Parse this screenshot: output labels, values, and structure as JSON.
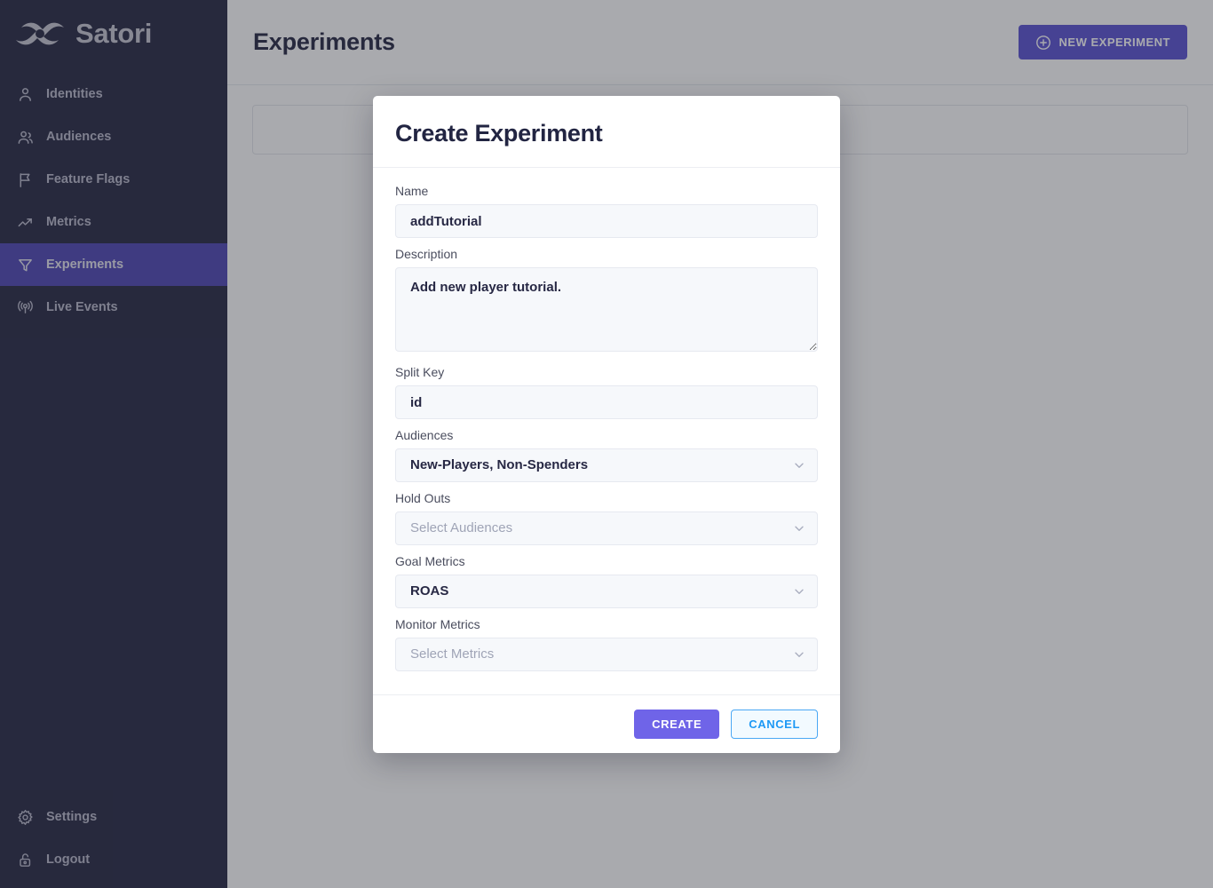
{
  "sidebar": {
    "brand": {
      "name": "Satori",
      "logo_icon": "satori-loop-logo"
    },
    "items": [
      {
        "label": "Identities",
        "icon": "user-icon",
        "active": false
      },
      {
        "label": "Audiences",
        "icon": "users-icon",
        "active": false
      },
      {
        "label": "Feature Flags",
        "icon": "flag-icon",
        "active": false
      },
      {
        "label": "Metrics",
        "icon": "trend-up-icon",
        "active": false
      },
      {
        "label": "Experiments",
        "icon": "funnel-icon",
        "active": true
      },
      {
        "label": "Live Events",
        "icon": "broadcast-icon",
        "active": false
      }
    ],
    "bottom_items": [
      {
        "label": "Settings",
        "icon": "gear-icon"
      },
      {
        "label": "Logout",
        "icon": "unlock-padlock-icon"
      }
    ],
    "colors": {
      "background": "#272844",
      "active_background": "#4f46b5",
      "text": "#b9bacb"
    }
  },
  "header": {
    "title": "Experiments",
    "new_experiment_label": "NEW EXPERIMENT",
    "new_experiment_icon": "plus-circle-icon",
    "accent_color": "#5b52d3"
  },
  "modal": {
    "title": "Create Experiment",
    "fields": {
      "name": {
        "label": "Name",
        "value": "addTutorial",
        "placeholder": ""
      },
      "description": {
        "label": "Description",
        "value": "Add new player tutorial.",
        "placeholder": ""
      },
      "split_key": {
        "label": "Split Key",
        "value": "id",
        "placeholder": ""
      },
      "audiences": {
        "label": "Audiences",
        "value": "New-Players, Non-Spenders",
        "placeholder": "Select Audiences",
        "icon": "chevron-down-icon"
      },
      "hold_outs": {
        "label": "Hold Outs",
        "value": "Select Audiences",
        "placeholder": "Select Audiences",
        "icon": "chevron-down-icon"
      },
      "goal_metrics": {
        "label": "Goal Metrics",
        "value": "ROAS",
        "placeholder": "Select Metrics",
        "icon": "chevron-down-icon"
      },
      "monitor_metrics": {
        "label": "Monitor Metrics",
        "value": "Select Metrics",
        "placeholder": "Select Metrics",
        "icon": "chevron-down-icon"
      }
    },
    "footer": {
      "create_label": "CREATE",
      "cancel_label": "CANCEL",
      "create_color": "#6f64e8",
      "cancel_color": "#1e99f5"
    }
  }
}
